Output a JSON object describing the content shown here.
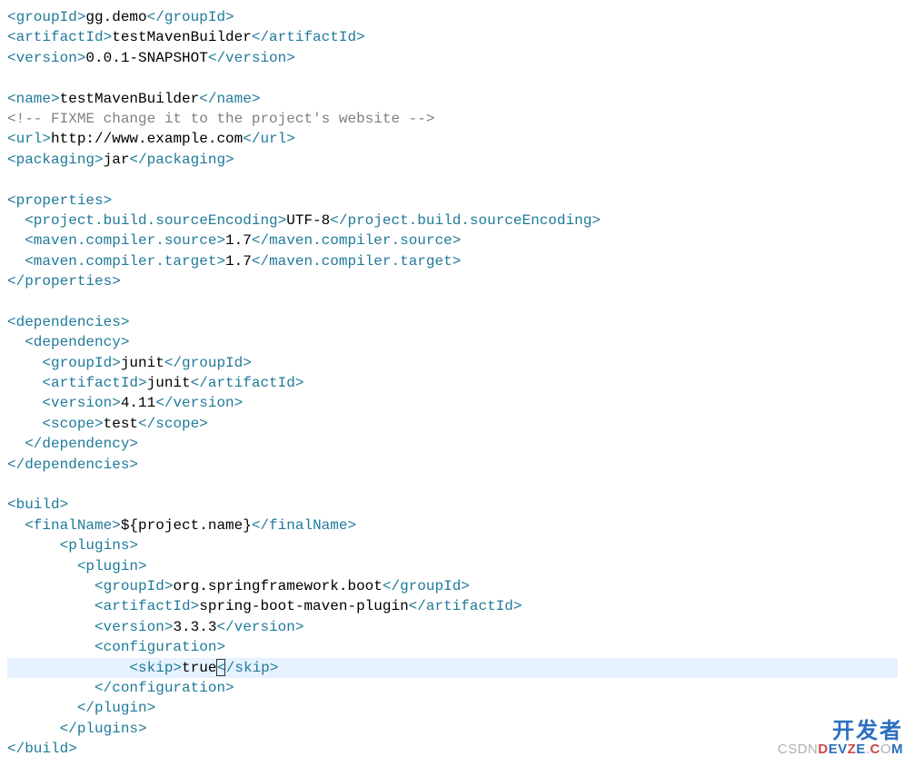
{
  "lines": [
    {
      "indent": 0,
      "parts": [
        {
          "t": "tag",
          "v": "<groupId>"
        },
        {
          "t": "text",
          "v": "gg.demo"
        },
        {
          "t": "tag",
          "v": "</groupId>"
        }
      ]
    },
    {
      "indent": 0,
      "parts": [
        {
          "t": "tag",
          "v": "<artifactId>"
        },
        {
          "t": "text",
          "v": "testMavenBuilder"
        },
        {
          "t": "tag",
          "v": "</artifactId>"
        }
      ]
    },
    {
      "indent": 0,
      "parts": [
        {
          "t": "tag",
          "v": "<version>"
        },
        {
          "t": "text",
          "v": "0.0.1-SNAPSHOT"
        },
        {
          "t": "tag",
          "v": "</version>"
        }
      ]
    },
    {
      "indent": 0,
      "parts": []
    },
    {
      "indent": 0,
      "parts": [
        {
          "t": "tag",
          "v": "<name>"
        },
        {
          "t": "text",
          "v": "testMavenBuilder"
        },
        {
          "t": "tag",
          "v": "</name>"
        }
      ]
    },
    {
      "indent": 0,
      "parts": [
        {
          "t": "comment",
          "v": "<!-- FIXME change it to the project's website -->"
        }
      ]
    },
    {
      "indent": 0,
      "parts": [
        {
          "t": "tag",
          "v": "<url>"
        },
        {
          "t": "text",
          "v": "http://www.example.com"
        },
        {
          "t": "tag",
          "v": "</url>"
        }
      ]
    },
    {
      "indent": 0,
      "parts": [
        {
          "t": "tag",
          "v": "<packaging>"
        },
        {
          "t": "text",
          "v": "jar"
        },
        {
          "t": "tag",
          "v": "</packaging>"
        }
      ]
    },
    {
      "indent": 0,
      "parts": []
    },
    {
      "indent": 0,
      "parts": [
        {
          "t": "tag",
          "v": "<properties>"
        }
      ]
    },
    {
      "indent": 1,
      "parts": [
        {
          "t": "tag",
          "v": "<project.build.sourceEncoding>"
        },
        {
          "t": "text",
          "v": "UTF-8"
        },
        {
          "t": "tag",
          "v": "</project.build.sourceEncoding>"
        }
      ]
    },
    {
      "indent": 1,
      "parts": [
        {
          "t": "tag",
          "v": "<maven.compiler.source>"
        },
        {
          "t": "text",
          "v": "1.7"
        },
        {
          "t": "tag",
          "v": "</maven.compiler.source>"
        }
      ]
    },
    {
      "indent": 1,
      "parts": [
        {
          "t": "tag",
          "v": "<maven.compiler.target>"
        },
        {
          "t": "text",
          "v": "1.7"
        },
        {
          "t": "tag",
          "v": "</maven.compiler.target>"
        }
      ]
    },
    {
      "indent": 0,
      "parts": [
        {
          "t": "tag",
          "v": "</properties>"
        }
      ]
    },
    {
      "indent": 0,
      "parts": []
    },
    {
      "indent": 0,
      "parts": [
        {
          "t": "tag",
          "v": "<dependencies>"
        }
      ]
    },
    {
      "indent": 1,
      "parts": [
        {
          "t": "tag",
          "v": "<dependency>"
        }
      ]
    },
    {
      "indent": 2,
      "parts": [
        {
          "t": "tag",
          "v": "<groupId>"
        },
        {
          "t": "text",
          "v": "junit"
        },
        {
          "t": "tag",
          "v": "</groupId>"
        }
      ]
    },
    {
      "indent": 2,
      "parts": [
        {
          "t": "tag",
          "v": "<artifactId>"
        },
        {
          "t": "text",
          "v": "junit"
        },
        {
          "t": "tag",
          "v": "</artifactId>"
        }
      ]
    },
    {
      "indent": 2,
      "parts": [
        {
          "t": "tag",
          "v": "<version>"
        },
        {
          "t": "text",
          "v": "4.11"
        },
        {
          "t": "tag",
          "v": "</version>"
        }
      ]
    },
    {
      "indent": 2,
      "parts": [
        {
          "t": "tag",
          "v": "<scope>"
        },
        {
          "t": "text",
          "v": "test"
        },
        {
          "t": "tag",
          "v": "</scope>"
        }
      ]
    },
    {
      "indent": 1,
      "parts": [
        {
          "t": "tag",
          "v": "</dependency>"
        }
      ]
    },
    {
      "indent": 0,
      "parts": [
        {
          "t": "tag",
          "v": "</dependencies>"
        }
      ]
    },
    {
      "indent": 0,
      "parts": []
    },
    {
      "indent": 0,
      "parts": [
        {
          "t": "tag",
          "v": "<build>"
        }
      ]
    },
    {
      "indent": 1,
      "parts": [
        {
          "t": "tag",
          "v": "<finalName>"
        },
        {
          "t": "text",
          "v": "${project.name}"
        },
        {
          "t": "tag",
          "v": "</finalName>"
        }
      ]
    },
    {
      "indent": 3,
      "parts": [
        {
          "t": "tag",
          "v": "<plugins>"
        }
      ]
    },
    {
      "indent": 4,
      "parts": [
        {
          "t": "tag",
          "v": "<plugin>"
        }
      ]
    },
    {
      "indent": 5,
      "parts": [
        {
          "t": "tag",
          "v": "<groupId>"
        },
        {
          "t": "text",
          "v": "org.springframework.boot"
        },
        {
          "t": "tag",
          "v": "</groupId>"
        }
      ]
    },
    {
      "indent": 5,
      "parts": [
        {
          "t": "tag",
          "v": "<artifactId>"
        },
        {
          "t": "text",
          "v": "spring-boot-maven-plugin"
        },
        {
          "t": "tag",
          "v": "</artifactId>"
        }
      ]
    },
    {
      "indent": 5,
      "parts": [
        {
          "t": "tag",
          "v": "<version>"
        },
        {
          "t": "text",
          "v": "3.3.3"
        },
        {
          "t": "tag",
          "v": "</version>"
        }
      ]
    },
    {
      "indent": 5,
      "parts": [
        {
          "t": "tag",
          "v": "<configuration>"
        }
      ]
    },
    {
      "indent": 7,
      "highlight": true,
      "cursor": true,
      "parts": [
        {
          "t": "tag",
          "v": "<skip>"
        },
        {
          "t": "text",
          "v": "true"
        },
        {
          "t": "tag",
          "v": "</skip>"
        }
      ]
    },
    {
      "indent": 5,
      "parts": [
        {
          "t": "tag",
          "v": "</configuration>"
        }
      ]
    },
    {
      "indent": 4,
      "parts": [
        {
          "t": "tag",
          "v": "</plugin>"
        }
      ]
    },
    {
      "indent": 3,
      "parts": [
        {
          "t": "tag",
          "v": "</plugins>"
        }
      ]
    },
    {
      "indent": 0,
      "parts": [
        {
          "t": "tag",
          "v": "</build>"
        }
      ]
    }
  ],
  "watermark": {
    "top": "开发者",
    "csdn": "CSDN",
    "d": "D",
    "ev": "EV",
    "z": "Z",
    "e": "E",
    "dot": ".",
    "c": "C",
    "o": "O",
    "m": "M"
  }
}
